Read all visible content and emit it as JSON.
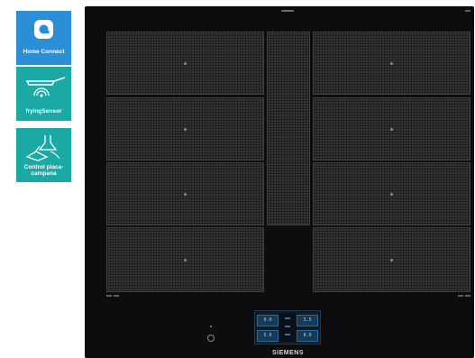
{
  "badges": [
    {
      "label": "Home Connect",
      "icon": "home-connect-icon",
      "color": "#2a8fd6"
    },
    {
      "label": "fryingSensor",
      "icon": "frying-pan-sensor-icon",
      "color": "#1ba9a6"
    },
    {
      "label": "Control placa-campana",
      "icon": "hob-hood-control-icon",
      "color": "#1ba9a6"
    }
  ],
  "cooktop": {
    "brand": "SIEMENS",
    "surface_color": "#0d0d0f",
    "zone_color": "#343537",
    "control_panel": {
      "keys": [
        "0.0",
        "3.5",
        "5.0",
        "8.0"
      ]
    }
  }
}
